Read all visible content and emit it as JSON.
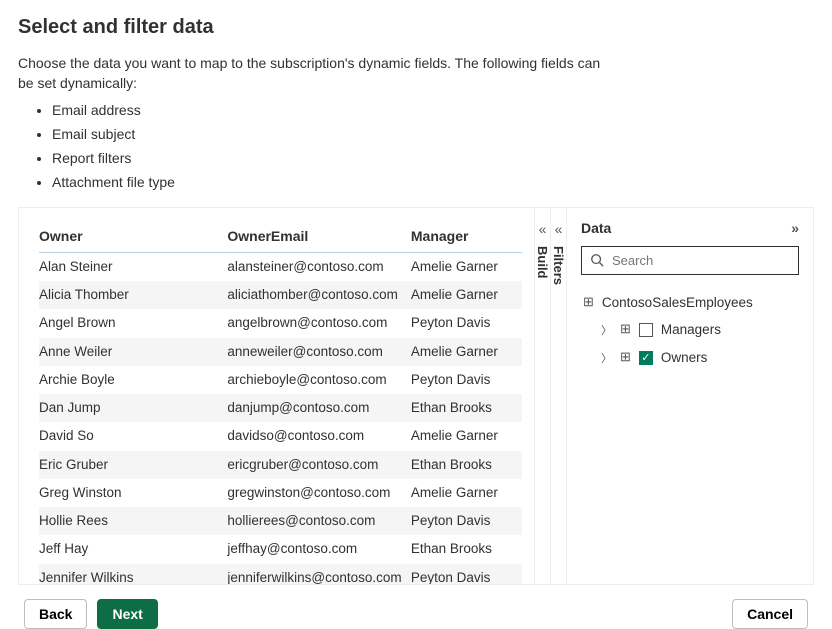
{
  "title": "Select and filter data",
  "intro": {
    "lead": "Choose the data you want to map to the subscription's dynamic fields. The following fields can be set dynamically:",
    "bullets": [
      "Email address",
      "Email subject",
      "Report filters",
      "Attachment file type"
    ]
  },
  "table": {
    "columns": [
      "Owner",
      "OwnerEmail",
      "Manager"
    ],
    "rows": [
      {
        "owner": "Alan Steiner",
        "email": "alansteiner@contoso.com",
        "manager": "Amelie Garner"
      },
      {
        "owner": "Alicia Thomber",
        "email": "aliciathomber@contoso.com",
        "manager": "Amelie Garner"
      },
      {
        "owner": "Angel Brown",
        "email": "angelbrown@contoso.com",
        "manager": "Peyton Davis"
      },
      {
        "owner": "Anne Weiler",
        "email": "anneweiler@contoso.com",
        "manager": "Amelie Garner"
      },
      {
        "owner": "Archie Boyle",
        "email": "archieboyle@contoso.com",
        "manager": "Peyton Davis"
      },
      {
        "owner": "Dan Jump",
        "email": "danjump@contoso.com",
        "manager": "Ethan Brooks"
      },
      {
        "owner": "David So",
        "email": "davidso@contoso.com",
        "manager": "Amelie Garner"
      },
      {
        "owner": "Eric Gruber",
        "email": "ericgruber@contoso.com",
        "manager": "Ethan Brooks"
      },
      {
        "owner": "Greg Winston",
        "email": "gregwinston@contoso.com",
        "manager": "Amelie Garner"
      },
      {
        "owner": "Hollie Rees",
        "email": "hollierees@contoso.com",
        "manager": "Peyton Davis"
      },
      {
        "owner": "Jeff Hay",
        "email": "jeffhay@contoso.com",
        "manager": "Ethan Brooks"
      },
      {
        "owner": "Jennifer Wilkins",
        "email": "jenniferwilkins@contoso.com",
        "manager": "Peyton Davis"
      }
    ]
  },
  "rails": {
    "build": "Build",
    "filters": "Filters"
  },
  "data_pane": {
    "title": "Data",
    "search_placeholder": "Search",
    "tree": {
      "root": "ContosoSalesEmployees",
      "children": [
        {
          "label": "Managers",
          "checked": false
        },
        {
          "label": "Owners",
          "checked": true
        }
      ]
    }
  },
  "footer": {
    "back": "Back",
    "next": "Next",
    "cancel": "Cancel"
  }
}
